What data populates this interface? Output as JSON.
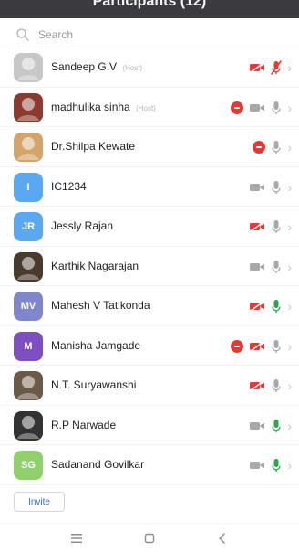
{
  "header": {
    "title": "Participants (12)"
  },
  "search": {
    "placeholder": "Search",
    "value": ""
  },
  "participants": [
    {
      "name": "Sandeep G.V",
      "tag": "(Host)",
      "avatar_type": "photo",
      "avatar_color": "#c7c7c7",
      "initials": "",
      "camera": "red-off",
      "mic": "red-off",
      "stop": false
    },
    {
      "name": "madhulika sinha",
      "tag": "(Host)",
      "avatar_type": "photo",
      "avatar_color": "#8b3a2e",
      "initials": "",
      "camera": "gray",
      "mic": "gray",
      "stop": true
    },
    {
      "name": "Dr.Shilpa Kewate",
      "tag": "",
      "avatar_type": "photo",
      "avatar_color": "#d3a56a",
      "initials": "",
      "camera": "none",
      "mic": "gray",
      "stop": true
    },
    {
      "name": "IC1234",
      "tag": "",
      "avatar_type": "initials",
      "avatar_color": "#5aa9f0",
      "initials": "I",
      "camera": "gray",
      "mic": "gray",
      "stop": false
    },
    {
      "name": "Jessly Rajan",
      "tag": "",
      "avatar_type": "initials",
      "avatar_color": "#5aa9f0",
      "initials": "JR",
      "camera": "red-off",
      "mic": "gray",
      "stop": false
    },
    {
      "name": "Karthik Nagarajan",
      "tag": "",
      "avatar_type": "photo",
      "avatar_color": "#4a3a2c",
      "initials": "",
      "camera": "gray",
      "mic": "gray",
      "stop": false
    },
    {
      "name": "Mahesh V Tatikonda",
      "tag": "",
      "avatar_type": "initials",
      "avatar_color": "#7f86c9",
      "initials": "MV",
      "camera": "red-off",
      "mic": "green",
      "stop": false
    },
    {
      "name": "Manisha Jamgade",
      "tag": "",
      "avatar_type": "initials",
      "avatar_color": "#7e4fc0",
      "initials": "M",
      "camera": "red-off",
      "mic": "gray",
      "stop": true
    },
    {
      "name": "N.T. Suryawanshi",
      "tag": "",
      "avatar_type": "photo",
      "avatar_color": "#6b5a48",
      "initials": "",
      "camera": "red-off",
      "mic": "gray",
      "stop": false
    },
    {
      "name": "R.P Narwade",
      "tag": "",
      "avatar_type": "photo",
      "avatar_color": "#333333",
      "initials": "",
      "camera": "gray",
      "mic": "green",
      "stop": false
    },
    {
      "name": "Sadanand Govilkar",
      "tag": "",
      "avatar_type": "initials",
      "avatar_color": "#8fd06d",
      "initials": "SG",
      "camera": "gray",
      "mic": "green",
      "stop": false
    }
  ],
  "invite": {
    "label": "Invite"
  },
  "bottom_nav": {
    "items": [
      "menu",
      "home",
      "back"
    ]
  }
}
